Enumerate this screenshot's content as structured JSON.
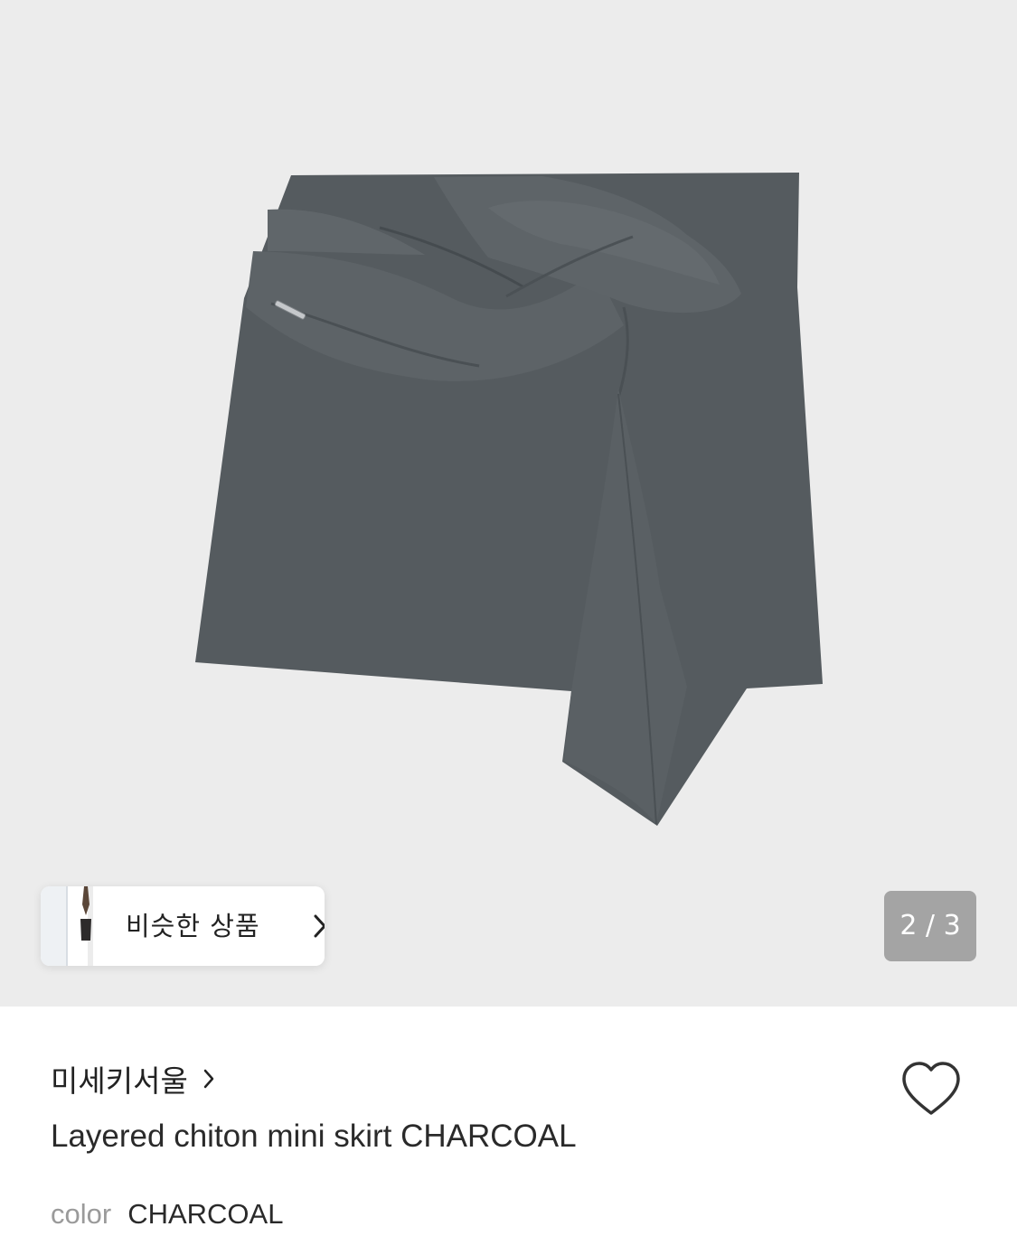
{
  "gallery": {
    "background": "#ececec",
    "image_alt": "Layered chiton mini skirt CHARCOAL",
    "skirt_color": "#555b5f",
    "similar_products": {
      "label": "비슷한 상품",
      "icon": "chevron-right-icon"
    },
    "page_indicator": {
      "current": 2,
      "total": 3,
      "text": "2 / 3"
    }
  },
  "product": {
    "brand": "미세키서울",
    "brand_icon": "chevron-right-icon",
    "title": "Layered chiton mini skirt CHARCOAL",
    "wishlist_icon": "heart-outline-icon",
    "option": {
      "label": "color",
      "value": "CHARCOAL"
    }
  }
}
